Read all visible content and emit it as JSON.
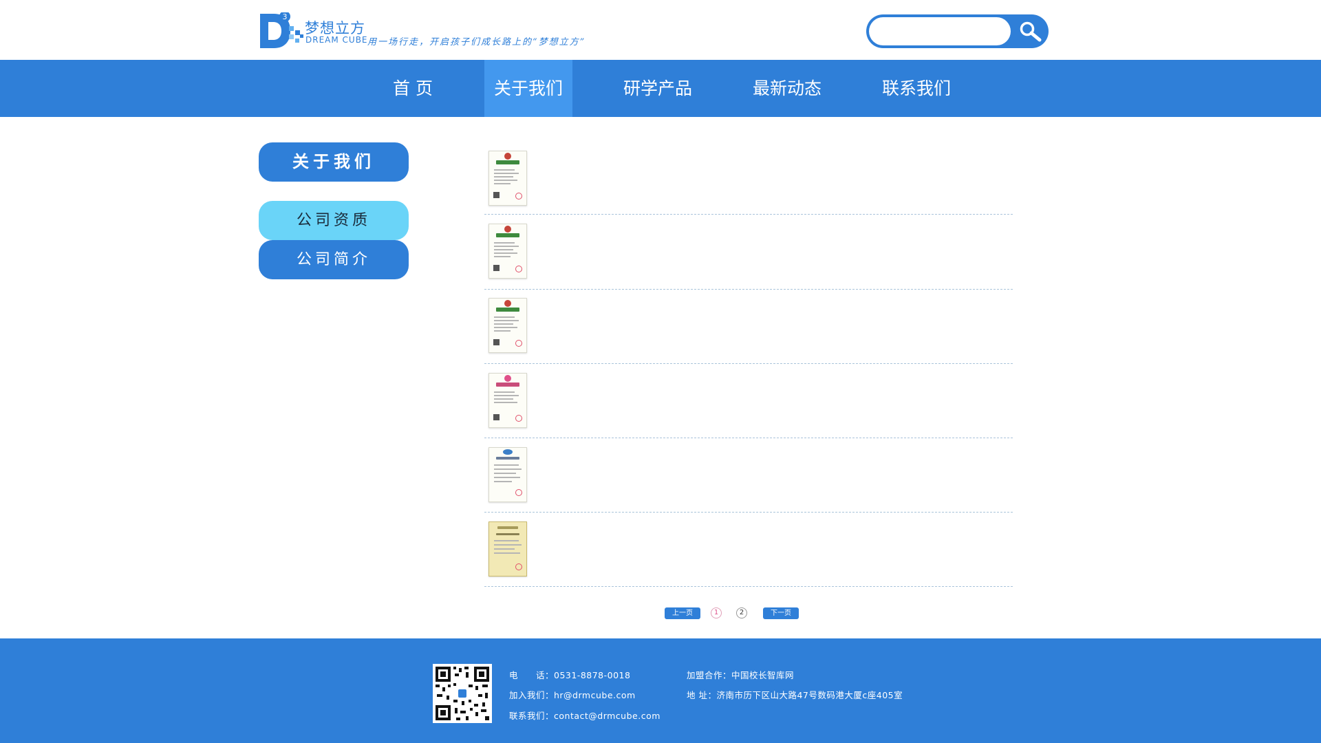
{
  "header": {
    "logo_cn": "梦想立方",
    "logo_en": "DREAM CUBE",
    "slogan": "用一场行走，开启孩子们成长路上的“梦想立方”",
    "search_placeholder": ""
  },
  "nav": {
    "items": [
      {
        "label": "首 页",
        "active": false
      },
      {
        "label": "关于我们",
        "active": true
      },
      {
        "label": "研学产品",
        "active": false
      },
      {
        "label": "最新动态",
        "active": false
      },
      {
        "label": "联系我们",
        "active": false
      }
    ]
  },
  "sidebar": {
    "title": "关于我们",
    "items": [
      {
        "label": "公司资质",
        "active": true
      },
      {
        "label": "公司简介",
        "active": false
      }
    ]
  },
  "list": {
    "items": [
      {
        "icon": "business-license-thumbnail"
      },
      {
        "icon": "business-license-thumbnail"
      },
      {
        "icon": "business-license-thumbnail"
      },
      {
        "icon": "business-license-pink-thumbnail"
      },
      {
        "icon": "certification-thumbnail"
      },
      {
        "icon": "iso-certificate-thumbnail"
      }
    ]
  },
  "pagination": {
    "prev": "上一页",
    "next": "下一页",
    "pages": [
      "1",
      "2"
    ],
    "current": "1"
  },
  "footer": {
    "phone": "电　　话：0531-8878-0018",
    "join": "加入我们：hr@drmcube.com",
    "contact": "联系我们：contact@drmcube.com",
    "franchise": "加盟合作：中国校长智库网",
    "address": "地  址：济南市历下区山大路47号数码港大厦c座405室"
  },
  "colors": {
    "brand_blue": "#2f7fd8",
    "nav_active": "#4398ee",
    "side_active": "#6ad4f8"
  }
}
